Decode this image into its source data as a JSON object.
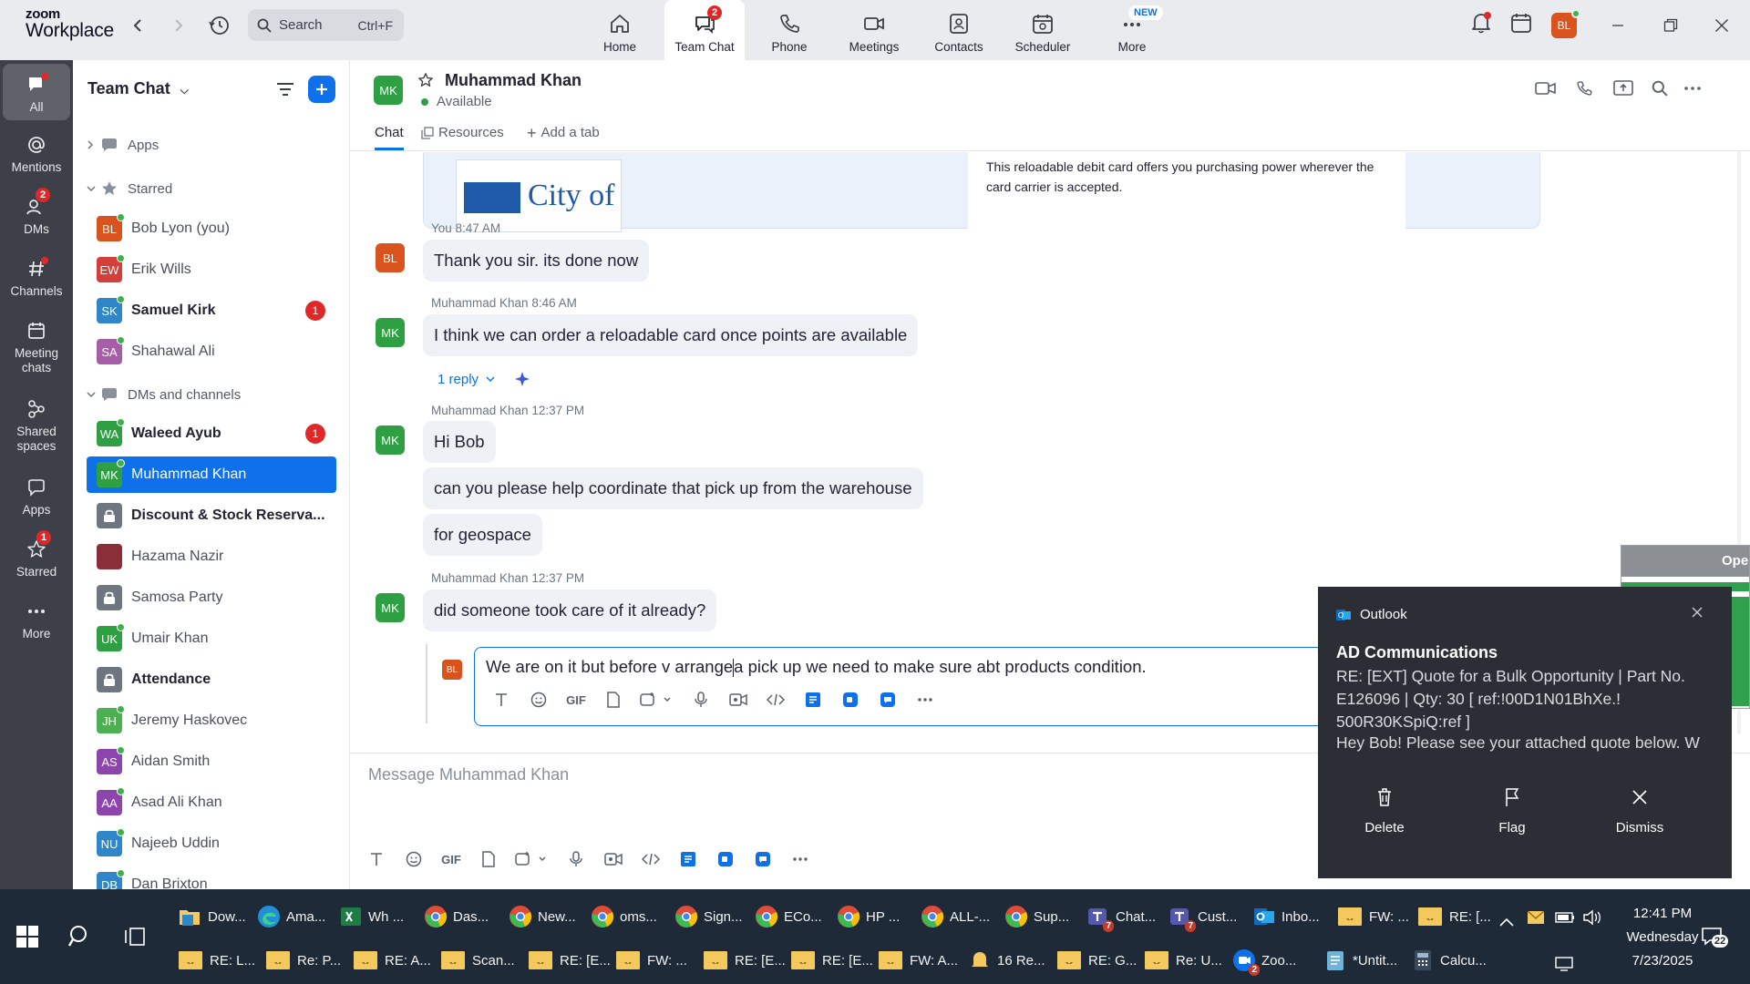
{
  "app": {
    "brand_line1": "zoom",
    "brand_line2": "Workplace"
  },
  "search": {
    "label": "Search",
    "shortcut": "Ctrl+F"
  },
  "topnav": [
    {
      "label": "Home",
      "icon": "home-icon"
    },
    {
      "label": "Team Chat",
      "icon": "chat-icon",
      "badge": "2"
    },
    {
      "label": "Phone",
      "icon": "phone-icon"
    },
    {
      "label": "Meetings",
      "icon": "video-icon"
    },
    {
      "label": "Contacts",
      "icon": "contacts-icon"
    },
    {
      "label": "Scheduler",
      "icon": "calendar-icon"
    },
    {
      "label": "More",
      "icon": "more-icon",
      "tag": "NEW"
    }
  ],
  "profile": {
    "initials": "BL",
    "color": "#d9531e"
  },
  "rail": [
    {
      "label": "All",
      "icon": "chat-bubble-icon"
    },
    {
      "label": "Mentions",
      "icon": "at-icon"
    },
    {
      "label": "DMs",
      "icon": "people-icon",
      "badge": "2"
    },
    {
      "label": "Channels",
      "icon": "hash-icon"
    },
    {
      "label": "Meeting chats",
      "icon": "calendar-icon"
    },
    {
      "label": "Shared spaces",
      "icon": "shared-icon"
    },
    {
      "label": "Apps",
      "icon": "apps-icon"
    },
    {
      "label": "Starred",
      "icon": "star-icon",
      "badge": "1"
    },
    {
      "label": "More",
      "icon": "more-icon"
    }
  ],
  "sidebar": {
    "title": "Team Chat",
    "apps_label": "Apps",
    "starred_label": "Starred",
    "dms_label": "DMs and channels",
    "starred": [
      {
        "initials": "BL",
        "name": "Bob Lyon (you)",
        "color": "#d9531e",
        "bold": false
      },
      {
        "initials": "EW",
        "name": "Erik Wills",
        "color": "#d43f3a",
        "bold": false
      },
      {
        "initials": "SK",
        "name": "Samuel Kirk",
        "color": "#2f86c8",
        "bold": true,
        "count": "1"
      },
      {
        "initials": "SA",
        "name": "Shahawal Ali",
        "color": "#a65ea8",
        "bold": false
      }
    ],
    "dms": [
      {
        "initials": "WA",
        "name": "Waleed Ayub",
        "color": "#2ea043",
        "bold": true,
        "count": "1"
      },
      {
        "initials": "MK",
        "name": "Muhammad Khan",
        "color": "#2ea043",
        "selected": true
      },
      {
        "initials": "",
        "name": "Discount & Stock Reserva...",
        "color": "#6e7680",
        "bold": true,
        "lock": true
      },
      {
        "initials": "",
        "name": "Hazama Nazir",
        "color": "#8a2f3a"
      },
      {
        "initials": "",
        "name": "Samosa Party",
        "color": "#6e7680",
        "lock": true
      },
      {
        "initials": "UK",
        "name": "Umair Khan",
        "color": "#2ea043"
      },
      {
        "initials": "",
        "name": "Attendance",
        "color": "#6e7680",
        "bold": true,
        "lock": true
      },
      {
        "initials": "JH",
        "name": "Jeremy Haskovec",
        "color": "#4caf50"
      },
      {
        "initials": "AS",
        "name": "Aidan Smith",
        "color": "#8e44ad"
      },
      {
        "initials": "AA",
        "name": "Asad Ali Khan",
        "color": "#8e44ad"
      },
      {
        "initials": "NU",
        "name": "Najeeb Uddin",
        "color": "#2f86c8"
      },
      {
        "initials": "DB",
        "name": "Dan Brixton",
        "color": "#2f86c8"
      }
    ]
  },
  "chat": {
    "contact": {
      "initials": "MK",
      "name": "Muhammad Khan",
      "status": "Available"
    },
    "tabs": {
      "chat": "Chat",
      "resources": "Resources",
      "add": "Add a tab"
    },
    "card": {
      "text_line1": "This reloadable debit card offers you purchasing power wherever the",
      "text_line2": "card carrier is accepted.",
      "logo_text": "City of"
    },
    "messages": [
      {
        "sender": "You",
        "time": "8:47 AM",
        "initials": "BL",
        "color": "#d9531e",
        "texts": [
          "Thank you sir. its done now"
        ]
      },
      {
        "sender": "Muhammad Khan",
        "time": "8:46 AM",
        "initials": "MK",
        "color": "#2ea043",
        "texts": [
          "I think we can order a reloadable card once points are available"
        ],
        "reply": "1 reply"
      },
      {
        "sender": "Muhammad Khan",
        "time": "12:37 PM",
        "initials": "MK",
        "color": "#2ea043",
        "texts": [
          "Hi Bob",
          "can you please help coordinate that pick up from the warehouse",
          "for geospace"
        ]
      },
      {
        "sender": "Muhammad Khan",
        "time": "12:37 PM",
        "initials": "MK",
        "color": "#2ea043",
        "texts": [
          "did someone took care of it already?"
        ]
      }
    ],
    "reply_draft": {
      "initials": "BL",
      "text_before": "We are on it but before v arrange",
      "text_after": "a pick up we need to make sure abt products condition."
    },
    "composer_placeholder": "Message Muhammad Khan",
    "toolbar_gif": "GIF"
  },
  "toast": {
    "app": "Outlook",
    "sender": "AD Communications",
    "subject": "RE: [EXT] Quote for a Bulk Opportunity | Part No. E126096 | Qty: 30    [ ref:!00D1N01BhXe.! 500R30KSpiQ:ref ]",
    "preview": "Hey Bob!  Please see your attached quote below. W",
    "actions": [
      "Delete",
      "Flag",
      "Dismiss"
    ],
    "behind_label": "Ope"
  },
  "taskbar": {
    "row1": [
      {
        "label": "Dow...",
        "kind": "folder",
        "color": "#f4c95d"
      },
      {
        "label": "Ama...",
        "kind": "edge",
        "color": "#1f8fd6"
      },
      {
        "label": "Wh ...",
        "kind": "excel",
        "color": "#1e7d45"
      },
      {
        "label": "Das...",
        "kind": "chrome",
        "color": "#dd4b39"
      },
      {
        "label": "New...",
        "kind": "chrome",
        "color": "#dd4b39"
      },
      {
        "label": "oms...",
        "kind": "chrome",
        "color": "#dd4b39"
      },
      {
        "label": "Sign...",
        "kind": "chrome",
        "color": "#dd4b39"
      },
      {
        "label": "ECo...",
        "kind": "chrome",
        "color": "#dd4b39"
      },
      {
        "label": "HP ...",
        "kind": "chrome",
        "color": "#dd4b39"
      },
      {
        "label": "ALL-...",
        "kind": "chrome",
        "color": "#dd4b39"
      },
      {
        "label": "Sup...",
        "kind": "chrome",
        "color": "#dd4b39"
      },
      {
        "label": "Chat...",
        "kind": "teams",
        "color": "#5558af",
        "num": "7"
      },
      {
        "label": "Cust...",
        "kind": "teams",
        "color": "#5558af",
        "num": "7"
      },
      {
        "label": "Inbo...",
        "kind": "outlook",
        "color": "#0f6cbd"
      },
      {
        "label": "FW: ...",
        "kind": "mail"
      },
      {
        "label": "RE: [...",
        "kind": "mail"
      }
    ],
    "row2": [
      {
        "label": "RE: L...",
        "kind": "mail"
      },
      {
        "label": "Re: P...",
        "kind": "mail"
      },
      {
        "label": "RE: A...",
        "kind": "mail"
      },
      {
        "label": "Scan...",
        "kind": "mail"
      },
      {
        "label": "RE: [E...",
        "kind": "mail"
      },
      {
        "label": "FW: ...",
        "kind": "mail"
      },
      {
        "label": "RE: [E...",
        "kind": "mail"
      },
      {
        "label": "RE: [E...",
        "kind": "mail"
      },
      {
        "label": "FW: A...",
        "kind": "mail"
      },
      {
        "label": "16 Re...",
        "kind": "bell"
      },
      {
        "label": "RE: G...",
        "kind": "mail"
      },
      {
        "label": "Re: U...",
        "kind": "mail"
      },
      {
        "label": "Zoo...",
        "kind": "zoom",
        "color": "#0e71eb",
        "num": "2"
      },
      {
        "label": "*Untit...",
        "kind": "notepad",
        "color": "#6fb3d9"
      },
      {
        "label": "Calcu...",
        "kind": "calc",
        "color": "#3a4a5c"
      }
    ],
    "clock": {
      "time": "12:41 PM",
      "day": "Wednesday",
      "date": "7/23/2025"
    },
    "notif_count": "22"
  }
}
